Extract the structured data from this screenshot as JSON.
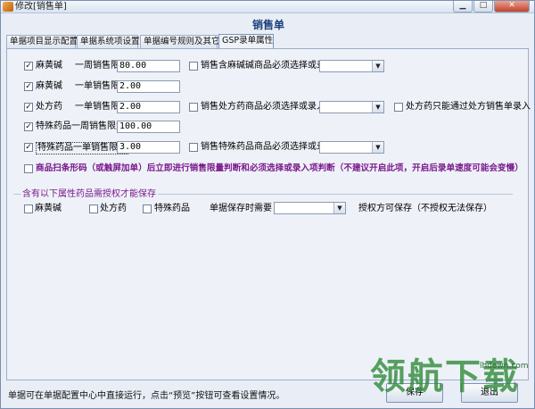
{
  "window": {
    "title": "修改[销售单]"
  },
  "header": {
    "title": "销售单"
  },
  "tabs": [
    {
      "label": "单据项目显示配置"
    },
    {
      "label": "单据系统项设置"
    },
    {
      "label": "单据编号规则及其它"
    },
    {
      "label": "GSP录单属性"
    }
  ],
  "rows": [
    {
      "label": "麻黄碱",
      "sublabel": "一周销售限量",
      "checked": true,
      "value": "80.00",
      "extra_label": "销售含麻碱碱商品必须选择或录入"
    },
    {
      "label": "麻黄碱",
      "sublabel": "一单销售限量",
      "checked": true,
      "value": "2.00"
    },
    {
      "label": "处方药",
      "sublabel": "一单销售限量",
      "checked": true,
      "value": "2.00",
      "extra_label": "销售处方药商品必须选择或录入",
      "extra2_label": "处方药只能通过处方销售单录入"
    },
    {
      "label": "特殊药品一周销售限量",
      "checked": true,
      "value": "100.00"
    },
    {
      "label": "特殊药品一单销售限量",
      "checked": true,
      "value": "3.00",
      "extra_label": "销售特殊药品商品必须选择或录入"
    }
  ],
  "scan_option": {
    "label": "商品扫条形码（或触屏加单）后立即进行销售限量判断和必须选择或录入项判断（不建议开启此项，开启后录单速度可能会变慢）"
  },
  "auth_group": {
    "title": "含有以下属性药品需授权才能保存",
    "items": [
      {
        "label": "麻黄碱"
      },
      {
        "label": "处方药"
      },
      {
        "label": "特殊药品"
      }
    ],
    "save_time_label": "单据保存时需要",
    "auth_note": "授权方可保存（不授权无法保存）"
  },
  "footer": {
    "note": "单据可在单据配置中心中直接运行，点击“预览”按钮可查看设置情况。",
    "save_label": "保存",
    "exit_label": "退出"
  },
  "watermark": {
    "text": "领航下载",
    "url": "lhdown.com"
  }
}
